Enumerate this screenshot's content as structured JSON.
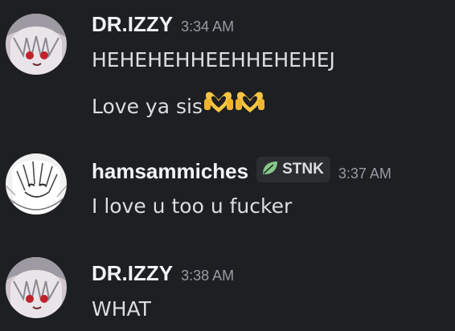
{
  "messages": [
    {
      "username": "DR.IZZY",
      "timestamp": "3:34 AM",
      "lines": [
        "HEHEHEHHEEHHEHEHEJ",
        "Love ya sis"
      ],
      "emoji": [
        "heart-hands-emoji",
        "heart-hands-emoji"
      ]
    },
    {
      "username": "hamsammiches",
      "tag": {
        "label": "STNK",
        "icon": "leaf-icon",
        "color": "#86c98a"
      },
      "timestamp": "3:37 AM",
      "lines": [
        "I love u too u fucker"
      ]
    },
    {
      "username": "DR.IZZY",
      "timestamp": "3:38 AM",
      "lines": [
        "WHAT"
      ]
    }
  ],
  "colors": {
    "background": "#1e1f22",
    "username": "#f2f3f5",
    "timestamp": "#949ba4",
    "text": "#dbdee1",
    "emoji": "#f5c542"
  }
}
